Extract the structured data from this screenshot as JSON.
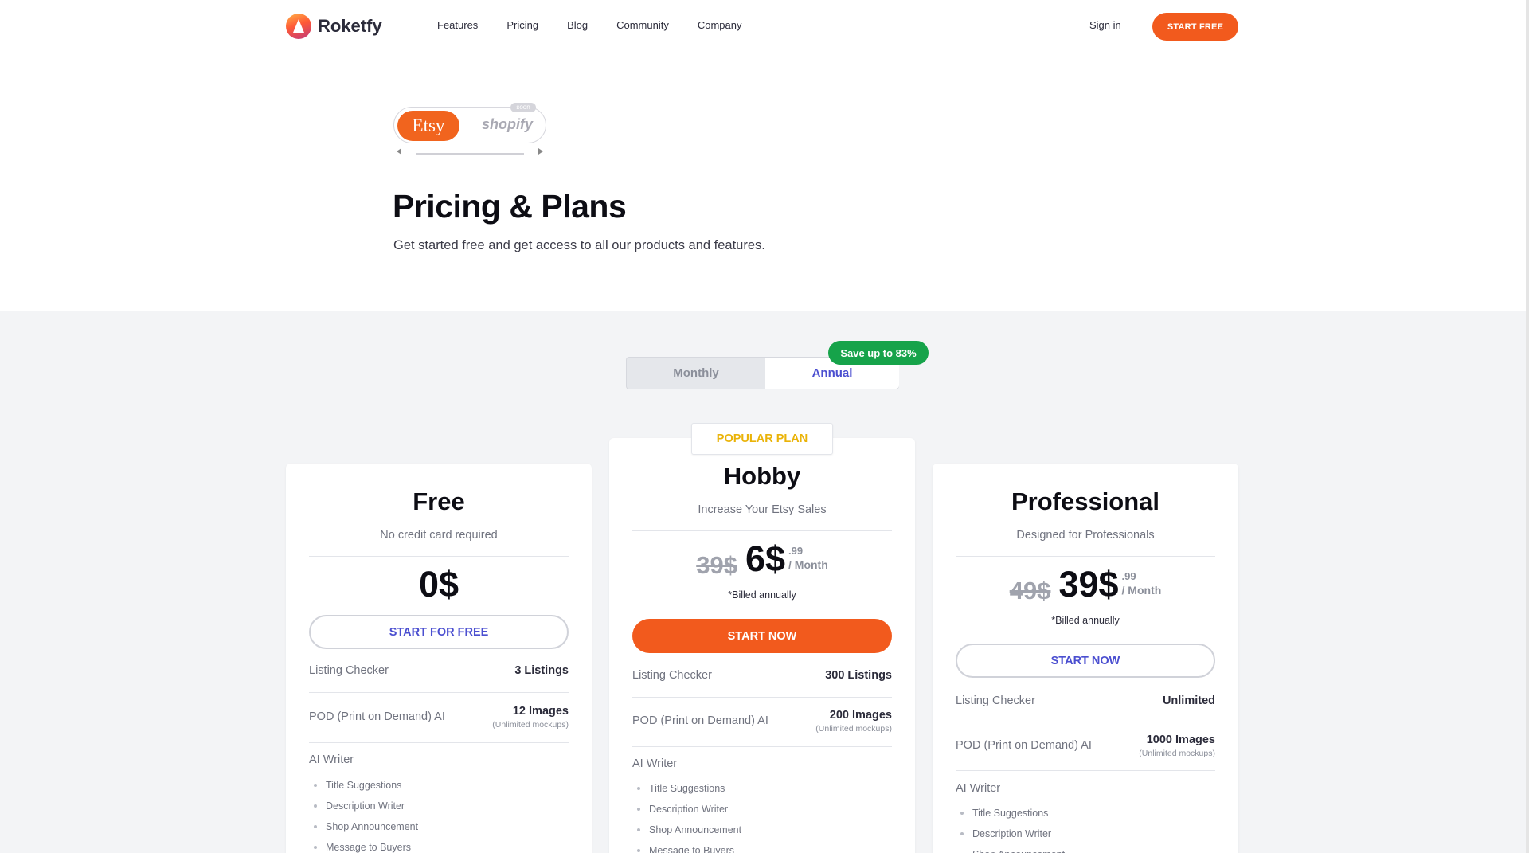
{
  "header": {
    "brand": "Roketfy",
    "nav": [
      "Features",
      "Pricing",
      "Blog",
      "Community",
      "Company"
    ],
    "sign_in": "Sign in",
    "cta": "START FREE"
  },
  "hero": {
    "platforms": {
      "active": "Etsy",
      "inactive": "shopify",
      "badge": "soon"
    },
    "title": "Pricing & Plans",
    "subtitle": "Get started free and get access to all our products and features."
  },
  "billing_toggle": {
    "monthly": "Monthly",
    "annual": "Annual",
    "selected": "Annual",
    "save_badge": "Save up to 83%"
  },
  "popular_tag": "POPULAR PLAN",
  "plans": [
    {
      "name": "Free",
      "description": "No credit card required",
      "price": "0$",
      "button": "START FOR FREE",
      "features": [
        {
          "label": "Listing Checker",
          "value": "3 Listings"
        },
        {
          "label": "POD (Print on Demand) AI",
          "value": "12 Images",
          "note": "(Unlimited mockups)"
        }
      ],
      "ai_writer": {
        "heading": "AI Writer",
        "items": [
          "Title Suggestions",
          "Description Writer",
          "Shop Announcement",
          "Message to Buyers"
        ]
      }
    },
    {
      "name": "Hobby",
      "description": "Increase Your Etsy Sales",
      "old_price": "39$",
      "price": "6$",
      "cents": ".99",
      "period": "/ Month",
      "billed": "*Billed annually",
      "button": "START NOW",
      "features": [
        {
          "label": "Listing Checker",
          "value": "300 Listings"
        },
        {
          "label": "POD (Print on Demand) AI",
          "value": "200 Images",
          "note": "(Unlimited mockups)"
        }
      ],
      "ai_writer": {
        "heading": "AI Writer",
        "items": [
          "Title Suggestions",
          "Description Writer",
          "Shop Announcement",
          "Message to Buyers"
        ]
      }
    },
    {
      "name": "Professional",
      "description": "Designed for Professionals",
      "old_price": "49$",
      "price": "39$",
      "cents": ".99",
      "period": "/ Month",
      "billed": "*Billed annually",
      "button": "START NOW",
      "features": [
        {
          "label": "Listing Checker",
          "value": "Unlimited"
        },
        {
          "label": "POD (Print on Demand) AI",
          "value": "1000 Images",
          "note": "(Unlimited mockups)"
        }
      ],
      "ai_writer": {
        "heading": "AI Writer",
        "items": [
          "Title Suggestions",
          "Description Writer",
          "Shop Announcement"
        ]
      }
    }
  ],
  "colors": {
    "brand_orange": "#f25a1d",
    "etsy_orange": "#f1641e",
    "accent_indigo": "#4b4fd0",
    "save_green": "#16a34a",
    "popular_yellow": "#eab308"
  }
}
